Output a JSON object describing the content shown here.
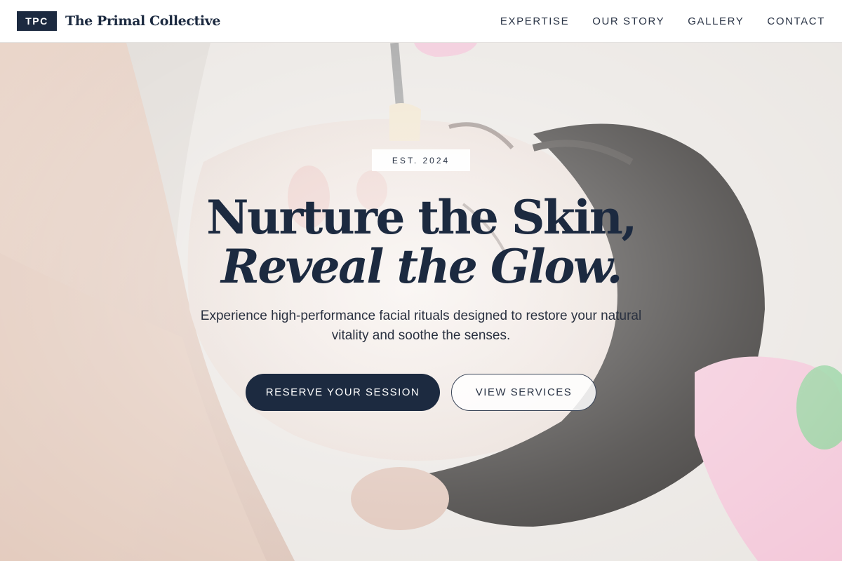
{
  "header": {
    "logo_text": "TPC",
    "brand_name": "The Primal Collective",
    "nav": [
      {
        "label": "EXPERTISE"
      },
      {
        "label": "OUR STORY"
      },
      {
        "label": "GALLERY"
      },
      {
        "label": "CONTACT"
      }
    ]
  },
  "hero": {
    "badge": "EST. 2024",
    "headline_line1": "Nurture the Skin,",
    "headline_line2": "Reveal the Glow.",
    "subcopy": "Experience high-performance facial rituals designed to restore your natural vitality and soothe the senses.",
    "primary_button": "RESERVE YOUR SESSION",
    "secondary_button": "VIEW SERVICES"
  },
  "colors": {
    "brand_navy": "#1c2a40",
    "header_bg": "#ffffff",
    "hero_tint": "#efe6e0"
  }
}
